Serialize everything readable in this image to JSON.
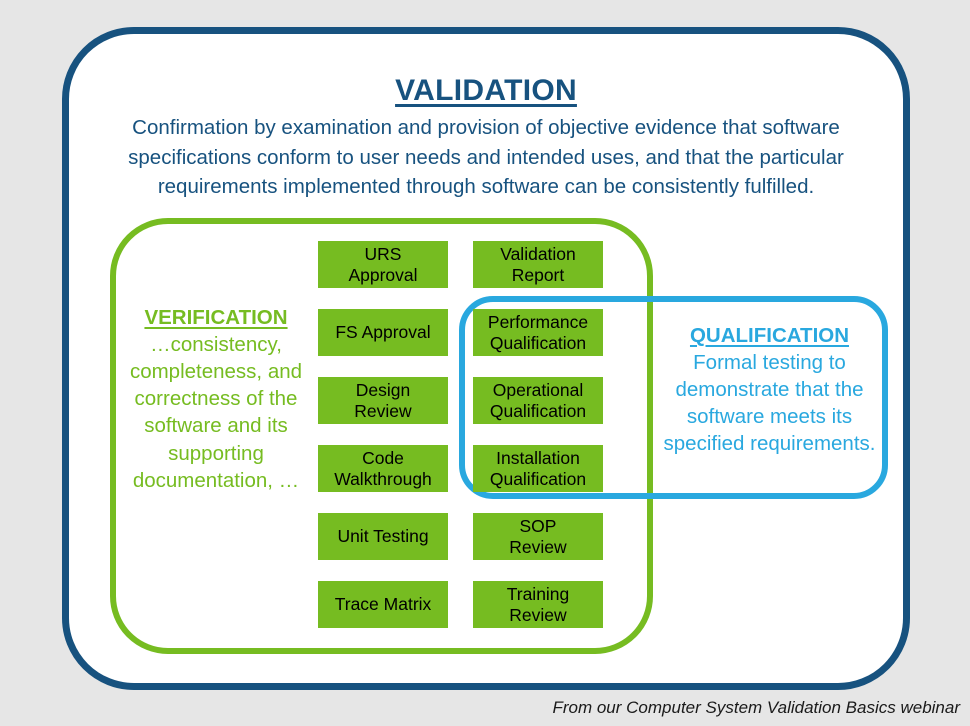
{
  "background_color": "#e6e6e6",
  "colors": {
    "navy": "#17527f",
    "green": "#76bc21",
    "cyan": "#29a8df",
    "box_text": "#000000"
  },
  "validation": {
    "title": "VALIDATION",
    "description": "Confirmation by examination and provision of objective evidence that software specifications conform to user needs and intended uses, and that the particular requirements implemented through software can be consistently fulfilled."
  },
  "verification": {
    "title": "VERIFICATION",
    "description": "…consistency, completeness, and correctness of the software and its supporting documentation, …"
  },
  "qualification": {
    "title": "QUALIFICATION",
    "description": "Formal testing to demonstrate that the software meets its specified requirements."
  },
  "left_column": [
    {
      "label": "URS\nApproval"
    },
    {
      "label": "FS Approval"
    },
    {
      "label": "Design\nReview"
    },
    {
      "label": "Code\nWalkthrough"
    },
    {
      "label": "Unit Testing"
    },
    {
      "label": "Trace Matrix"
    }
  ],
  "right_column": [
    {
      "label": "Validation\nReport"
    },
    {
      "label": "Performance\nQualification"
    },
    {
      "label": "Operational\nQualification"
    },
    {
      "label": "Installation\nQualification"
    },
    {
      "label": "SOP\nReview"
    },
    {
      "label": "Training\nReview"
    }
  ],
  "footer": {
    "caption": "From our Computer System Validation Basics webinar"
  }
}
